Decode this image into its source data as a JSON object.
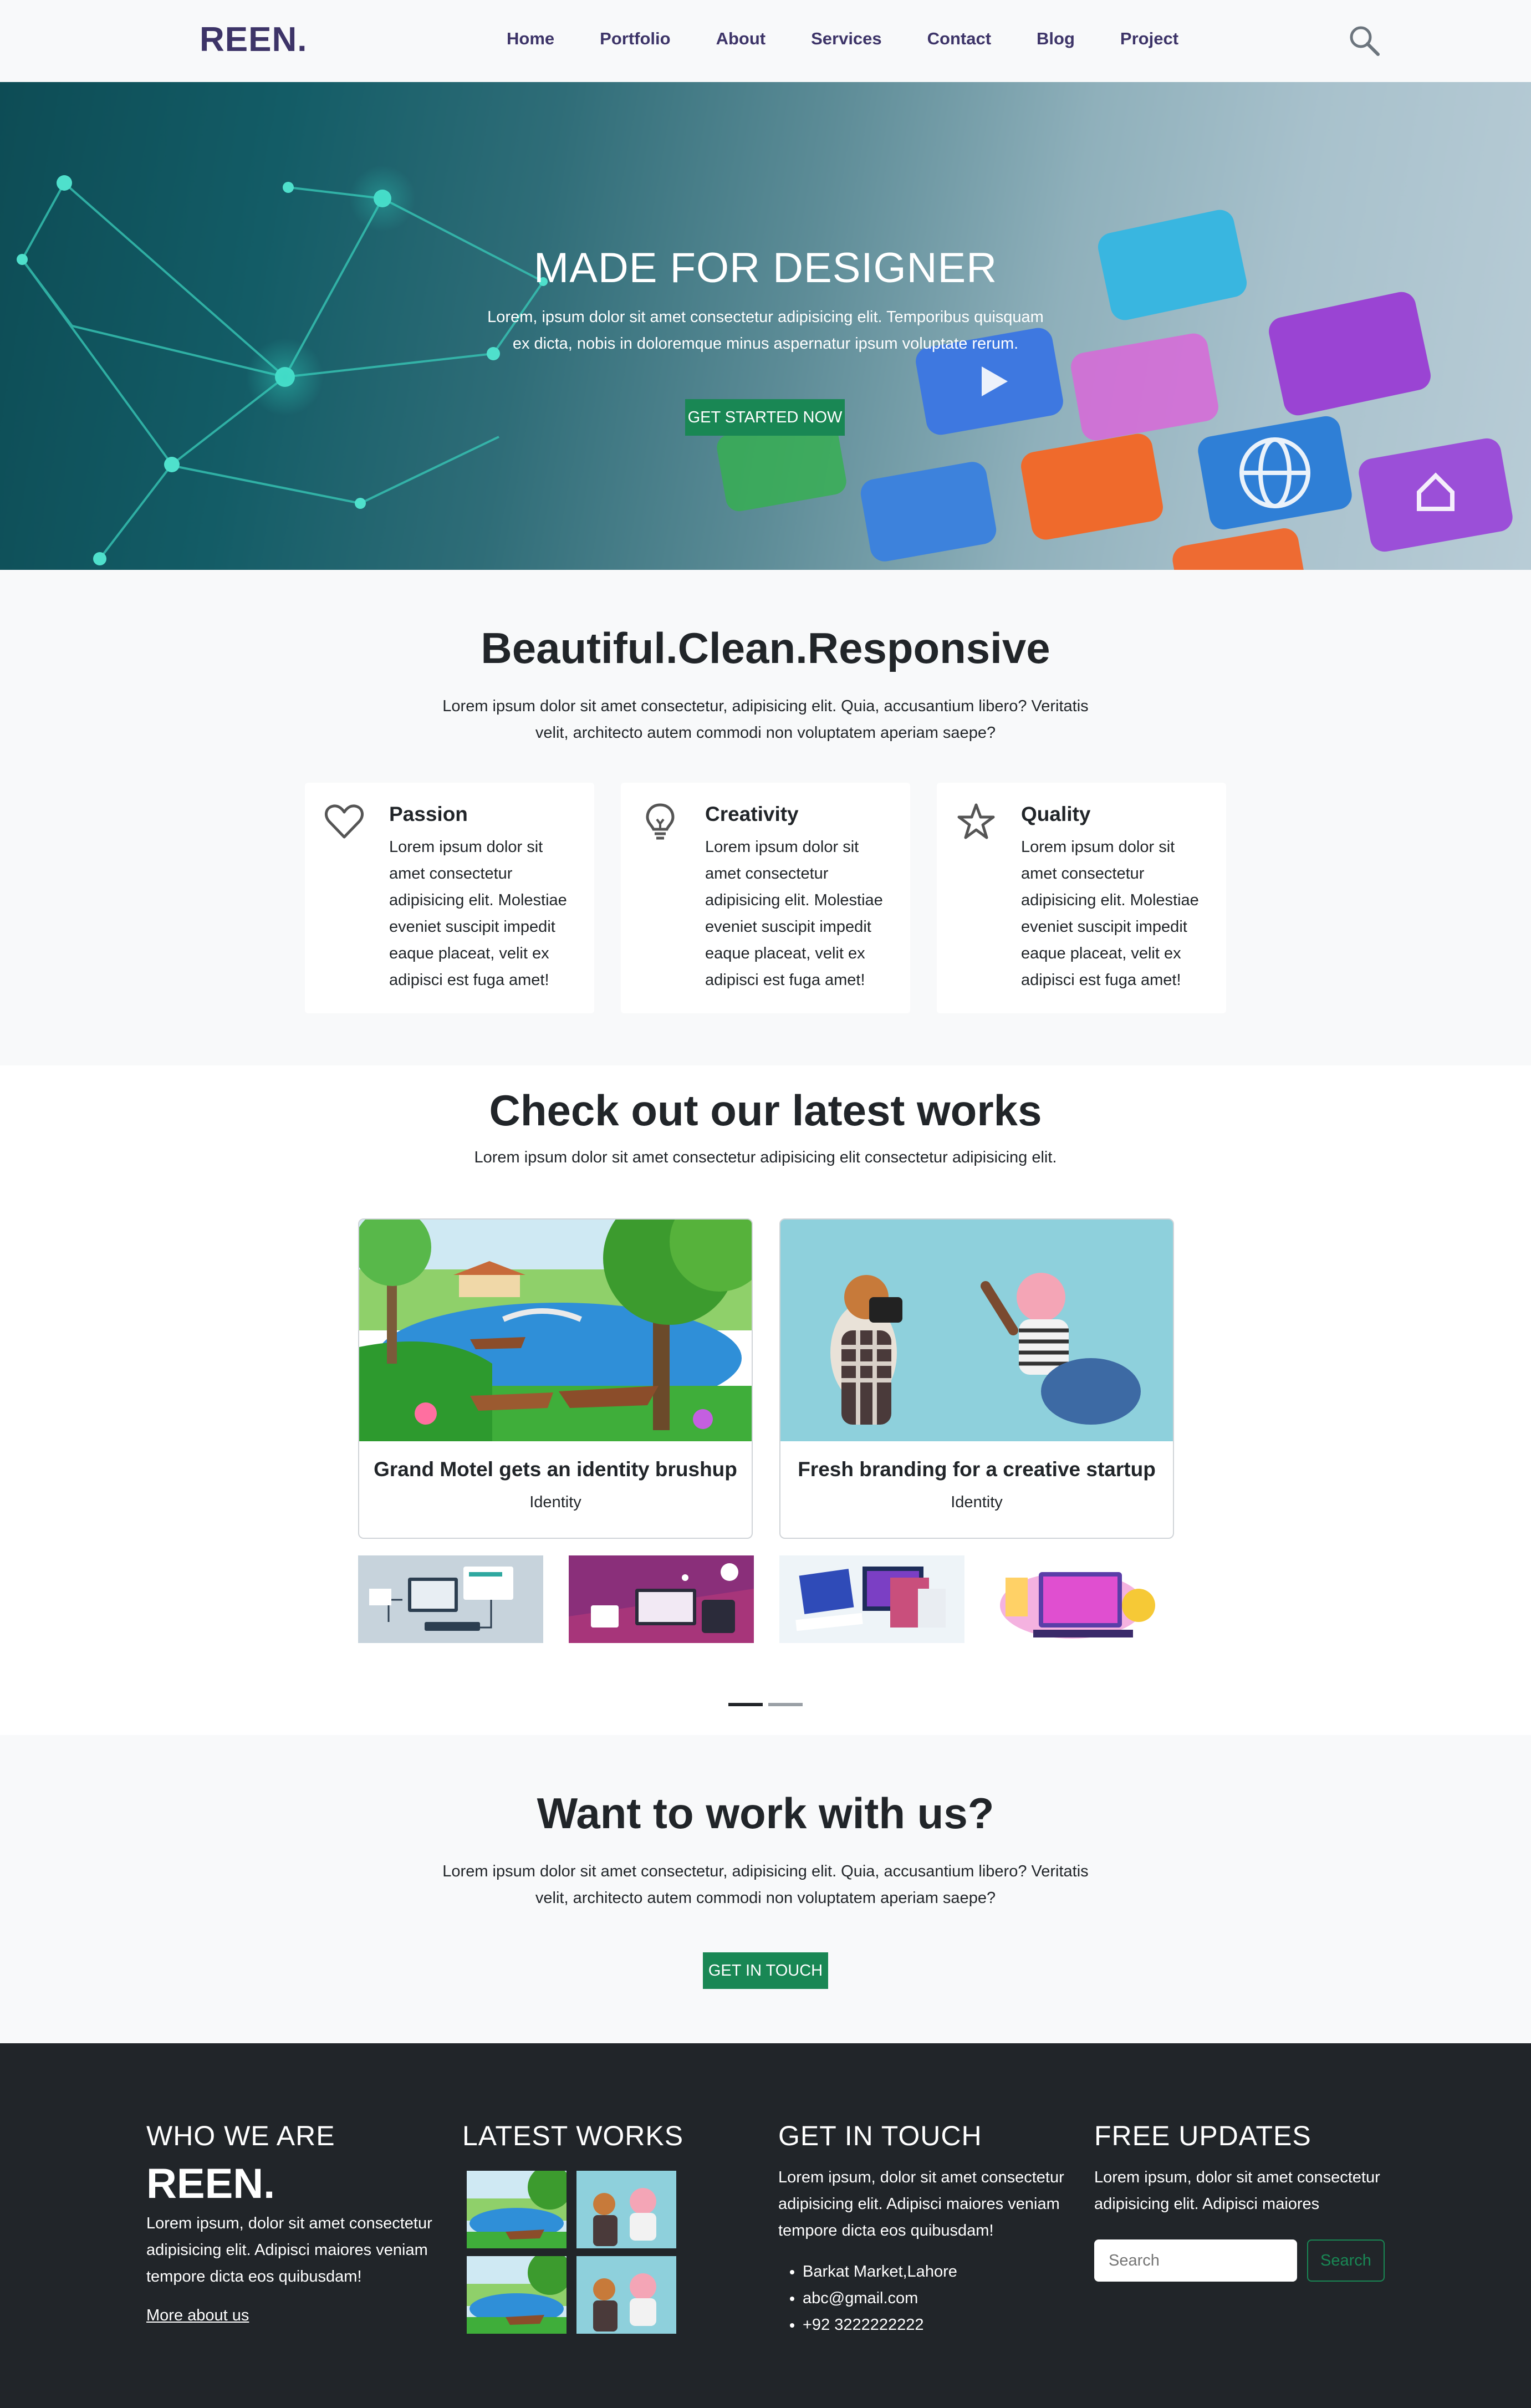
{
  "navbar": {
    "brand": "REEN.",
    "links": [
      "Home",
      "Portfolio",
      "About",
      "Services",
      "Contact",
      "Blog",
      "Project"
    ],
    "search_icon": "search-icon"
  },
  "hero": {
    "title": "MADE FOR DESIGNER",
    "text": "Lorem, ipsum dolor sit amet consectetur adipisicing elit. Temporibus quisquam ex dicta, nobis in doloremque minus aspernatur ipsum voluptate rerum.",
    "button": "GET STARTED NOW"
  },
  "features": {
    "title": "Beautiful.Clean.Responsive",
    "text": "Lorem ipsum dolor sit amet consectetur, adipisicing elit. Quia, accusantium libero? Veritatis velit, architecto autem commodi non voluptatem aperiam saepe?",
    "cards": [
      {
        "icon": "heart-icon",
        "title": "Passion",
        "text": "Lorem ipsum dolor sit amet consectetur adipisicing elit. Molestiae eveniet suscipit impedit eaque placeat, velit ex adipisci est fuga amet!"
      },
      {
        "icon": "lightbulb-icon",
        "title": "Creativity",
        "text": "Lorem ipsum dolor sit amet consectetur adipisicing elit. Molestiae eveniet suscipit impedit eaque placeat, velit ex adipisci est fuga amet!"
      },
      {
        "icon": "star-icon",
        "title": "Quality",
        "text": "Lorem ipsum dolor sit amet consectetur adipisicing elit. Molestiae eveniet suscipit impedit eaque placeat, velit ex adipisci est fuga amet!"
      }
    ]
  },
  "works": {
    "title": "Check out our latest works",
    "text": "Lorem ipsum dolor sit amet consectetur adipisicing elit consectetur adipisicing elit.",
    "items": [
      {
        "title": "Grand Motel gets an identity brushup",
        "category": "Identity"
      },
      {
        "title": "Fresh branding for a creative startup",
        "category": "Identity"
      }
    ],
    "carousel_slides": 2,
    "active_slide": 1
  },
  "cta": {
    "title": "Want to work with us?",
    "text": "Lorem ipsum dolor sit amet consectetur, adipisicing elit. Quia, accusantium libero? Veritatis velit, architecto autem commodi non voluptatem aperiam saepe?",
    "button": "GET IN TOUCH"
  },
  "footer": {
    "who": {
      "heading": "WHO WE ARE",
      "brand": "REEN.",
      "text": "Lorem ipsum, dolor sit amet consectetur adipisicing elit. Adipisci maiores veniam tempore dicta eos quibusdam!",
      "link": "More about us"
    },
    "latest": {
      "heading": "LATEST WORKS"
    },
    "touch": {
      "heading": "GET IN TOUCH",
      "text": "Lorem ipsum, dolor sit amet consectetur adipisicing elit. Adipisci maiores veniam tempore dicta eos quibusdam!",
      "contacts": [
        "Barkat Market,Lahore",
        "abc@gmail.com",
        "+92 3222222222"
      ]
    },
    "updates": {
      "heading": "FREE UPDATES",
      "text": "Lorem ipsum, dolor sit amet consectetur adipisicing elit. Adipisci maiores",
      "search_placeholder": "Search",
      "search_button": "Search"
    }
  },
  "colors": {
    "brand": "#3d3468",
    "primary_button": "#198754",
    "footer_bg": "#212529",
    "light_bg": "#f8f9fa"
  }
}
